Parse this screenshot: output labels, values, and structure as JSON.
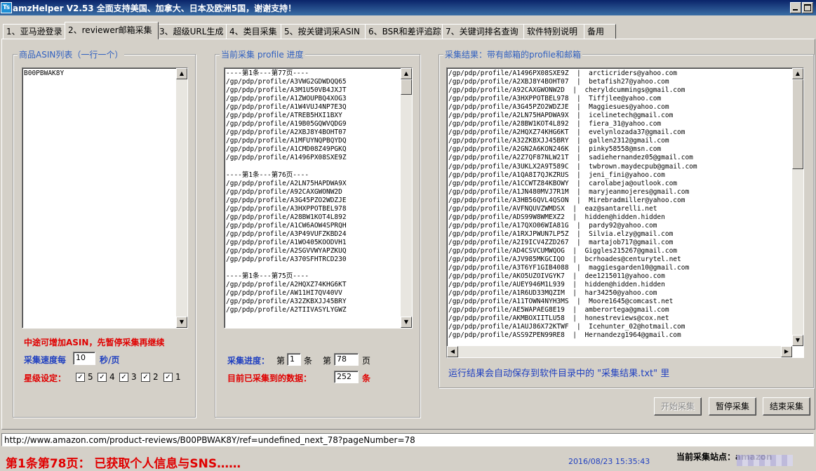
{
  "window": {
    "title": "amzHelper V2.53 全面支持美国、加拿大、日本及欧洲5国，谢谢支持！",
    "icon": "amz-app-icon",
    "icon_letter": "Ts"
  },
  "tabs": [
    {
      "label": "1、亚马逊登录",
      "active": false
    },
    {
      "label": "2、reviewer邮箱采集",
      "active": true
    },
    {
      "label": "3、超级URL生成",
      "active": false
    },
    {
      "label": "4、类目采集",
      "active": false
    },
    {
      "label": "5、按关键词采ASIN",
      "active": false
    },
    {
      "label": "6、BSR和差评追踪",
      "active": false
    },
    {
      "label": "7、关键词排名查询",
      "active": false
    },
    {
      "label": "软件特别说明",
      "active": false
    },
    {
      "label": "备用",
      "active": false
    }
  ],
  "asin_panel": {
    "legend": "商品ASIN列表（一行一个）",
    "content": "B00PBWAK8Y",
    "hint": "中途可增加ASIN，先暂停采集再继续",
    "speed_label": "采集速度每",
    "speed_value": "10",
    "speed_unit": "秒/页",
    "star_label": "星级设定：",
    "stars": [
      {
        "label": "5",
        "checked": true
      },
      {
        "label": "4",
        "checked": true
      },
      {
        "label": "3",
        "checked": true
      },
      {
        "label": "2",
        "checked": true
      },
      {
        "label": "1",
        "checked": true
      }
    ]
  },
  "progress_panel": {
    "legend": "当前采集 profile 进度",
    "content": "----第1条---第77页----\n/gp/pdp/profile/A3VWG2GDWDQQ65\n/gp/pdp/profile/A3M1U50VB4JXJT\n/gp/pdp/profile/A1ZWOUPBQ4XOG3\n/gp/pdp/profile/A1W4VUJ4NP7E3Q\n/gp/pdp/profile/ATREB5HXI1BXY\n/gp/pdp/profile/A19B05GQWVQDG9\n/gp/pdp/profile/A2XBJ8Y4BOHT07\n/gp/pdp/profile/A1MFUYNQPBQYDQ\n/gp/pdp/profile/A1CMD08Z49PGKQ\n/gp/pdp/profile/A1496PX08SXE9Z\n\n----第1条---第76页----\n/gp/pdp/profile/A2LN75HAPDWA9X\n/gp/pdp/profile/A92CAXGWONW2D\n/gp/pdp/profile/A3G45PZO2WDZJE\n/gp/pdp/profile/A3HXPPOTBEL978\n/gp/pdp/profile/A28BW1KOT4L892\n/gp/pdp/profile/A1CW6AOW4SPRQH\n/gp/pdp/profile/A3P49VUFZKBD24\n/gp/pdp/profile/A1WO405KOODVH1\n/gp/pdp/profile/A2SGVVWYAPZKUQ\n/gp/pdp/profile/A370SFHTRCD230\n\n----第1条---第75页----\n/gp/pdp/profile/A2HQXZ74KHG6KT\n/gp/pdp/profile/AW11HI7QV40VV\n/gp/pdp/profile/A32ZKBXJJ45BRY\n/gp/pdp/profile/A2TIIVASYLYGWZ",
    "progress_label": "采集进度：",
    "item_prefix": "第",
    "item_value": "1",
    "item_unit": "条",
    "page_prefix": "第",
    "page_value": "78",
    "page_unit": "页",
    "count_label": "目前已采集到的数据：",
    "count_value": "252",
    "count_unit": "条"
  },
  "results_panel": {
    "legend": "采集结果：带有邮箱的profile和邮箱",
    "content": "/gp/pdp/profile/A1496PX08SXE9Z  |  arcticriders@yahoo.com\n/gp/pdp/profile/A2XBJ8Y4BOHT07  |  betafish27@yahoo.com\n/gp/pdp/profile/A92CAXGWONW2D  |  cheryldcummings@gmail.com\n/gp/pdp/profile/A3HXPPOTBEL978  |  Tiffjlee@yahoo.com\n/gp/pdp/profile/A3G45PZO2WDZJE  |  Maggiesues@yahoo.com\n/gp/pdp/profile/A2LN75HAPDWA9X  |  icelinetech@gmail.com\n/gp/pdp/profile/A28BW1KOT4L892  |  fiera_31@yahoo.com\n/gp/pdp/profile/A2HQXZ74KHG6KT  |  evelynlozada37@gmail.com\n/gp/pdp/profile/A32ZKBXJJ45BRY  |  gallen2312@gmail.com\n/gp/pdp/profile/A2GN2A6KON246K  |  pinky58558@msn.com\n/gp/pdp/profile/A2Z7QF87NLW21T  |  sadiehernandez05@gmail.com\n/gp/pdp/profile/A3UKLX2A9T589C  |  twbrown.maydecpub@gmail.com\n/gp/pdp/profile/A1QA8I7QJKZRUS  |  jeni_fini@yahoo.com\n/gp/pdp/profile/A1CCWTZ84KBOWY  |  carolabeja@outlook.com\n/gp/pdp/profile/A1JN480MVJ7R1M  |  maryjeanmojeres@gmail.com\n/gp/pdp/profile/A3HB56QVL4QSON  |  Mirebradmiller@yahoo.com\n/gp/pdp/profile/AVFNQUVZWMDSX  |  eaz@santarelli.net\n/gp/pdp/profile/ADS99W8WMEXZ2  |  hidden@hidden.hidden\n/gp/pdp/profile/A17QXO06WIA81G  |  pardy92@yahoo.com\n/gp/pdp/profile/A1RXJPWUN7LP5Z  |  Silvia.elzy@gmail.com\n/gp/pdp/profile/A2I9ICV4ZZD267  |  martajob717@gmail.com\n/gp/pdp/profile/AD4CSVCUMWQOG  |  Giggles215267@gmail.com\n/gp/pdp/profile/AJV985MKGCIQO  |  bcrhoades@centurytel.net\n/gp/pdp/profile/A3T6YF1GIB4088  |  maggiesgarden10@gmail.com\n/gp/pdp/profile/AKO5UZOIVGYK7  |  dee1215011@yahoo.com\n/gp/pdp/profile/AUEY946M1L939  |  hidden@hidden.hidden\n/gp/pdp/profile/A1R6UD33MQZIM  |  har34250@yahoo.com\n/gp/pdp/profile/A11TOWN4NYH3MS  |  Moore1645@comcast.net\n/gp/pdp/profile/AE5WAPAEG8E19  |  amberortega@gmail.com\n/gp/pdp/profile/AKMBOXIITLU58  |  honestreviews@cox.net\n/gp/pdp/profile/A1AUJ86X72KTWF  |  Icehunter_02@hotmail.com\n/gp/pdp/profile/ASS9ZPEN99RE8  |  Hernandezg1964@gmail.com",
    "note": "运行结果会自动保存到软件目录中的 \"采集结果.txt\" 里"
  },
  "buttons": {
    "start": "开始采集",
    "pause": "暂停采集",
    "stop": "结束采集"
  },
  "url_bar": "http://www.amazon.com/product-reviews/B00PBWAK8Y/ref=undefined_next_78?pageNumber=78",
  "status": {
    "main": "第1条第78页：  已获取个人信息与SNS……",
    "timestamp": "2016/08/23 15:35:43",
    "site": "当前采集站点：amazon"
  },
  "colors": {
    "titlebar": "#0a246a",
    "accent_blue": "#2040c0",
    "accent_red": "#e00000",
    "window_bg": "#d4d0c8"
  }
}
